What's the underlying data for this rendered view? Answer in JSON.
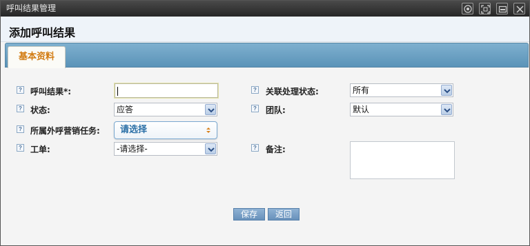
{
  "window": {
    "title": "呼叫结果管理",
    "controls": [
      "restore-icon",
      "maximize-icon",
      "minimize-icon",
      "close-icon"
    ]
  },
  "header": {
    "title": "添加呼叫结果"
  },
  "tabs": [
    {
      "label": "基本资料",
      "active": true
    }
  ],
  "form": {
    "call_result": {
      "label": "呼叫结果*:",
      "value": ""
    },
    "status": {
      "label": "状态:",
      "value": "应答"
    },
    "campaign": {
      "label": "所属外呼营销任务:",
      "value": "请选择"
    },
    "ticket": {
      "label": "工单:",
      "value": "-请选择-"
    },
    "related_status": {
      "label": "关联处理状态:",
      "value": "所有"
    },
    "team": {
      "label": "团队:",
      "value": "默认"
    },
    "remark": {
      "label": "备注:",
      "value": ""
    }
  },
  "buttons": {
    "save": "保存",
    "back": "返回"
  },
  "help_icon_glyph": "?",
  "colors": {
    "accent": "#5a93b8",
    "tab_text": "#d27b12",
    "button": "#6891bb"
  }
}
